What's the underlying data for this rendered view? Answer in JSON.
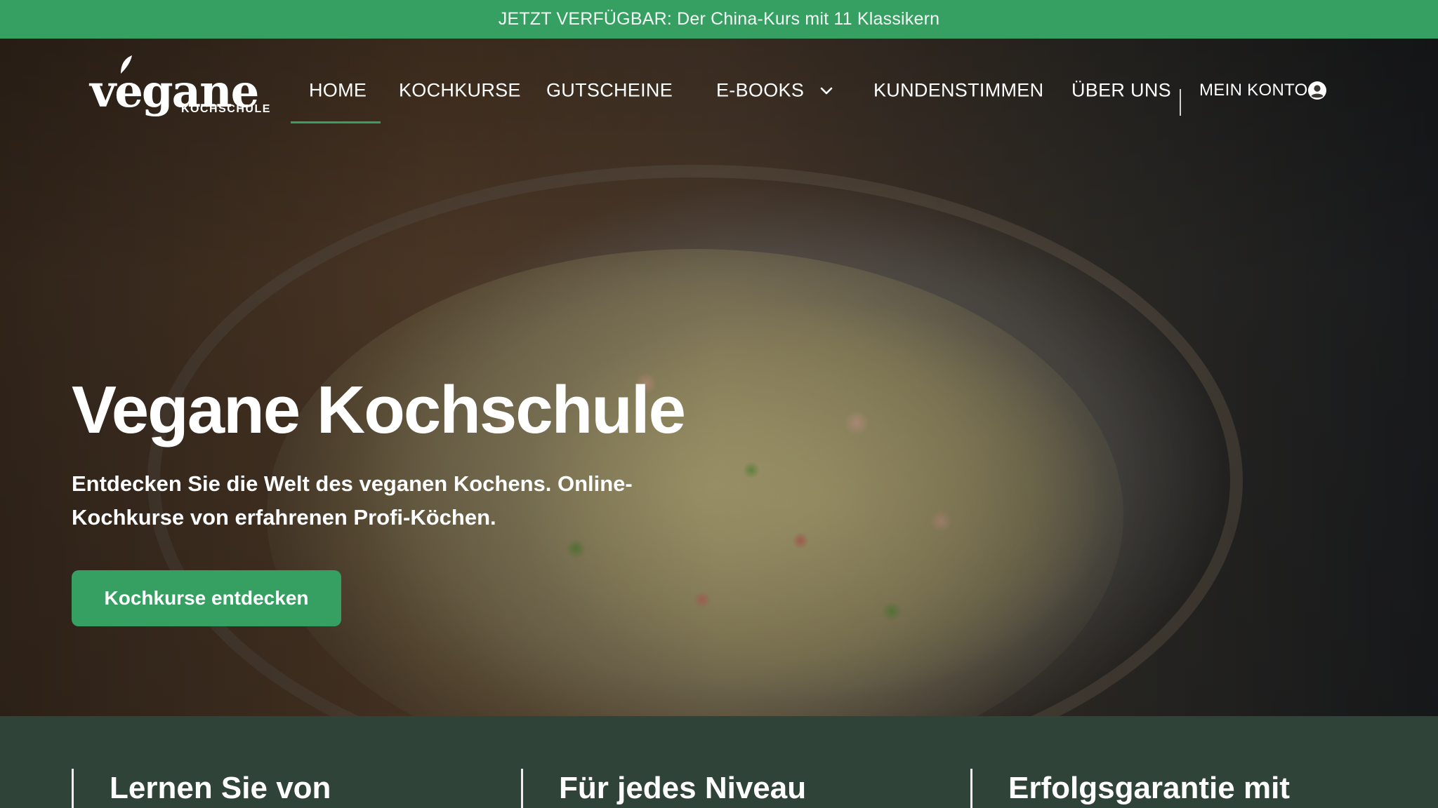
{
  "announcement": {
    "text": "JETZT VERFÜGBAR: Der China-Kurs mit 11 Klassikern"
  },
  "logo": {
    "wordmark": "vegane",
    "subtitle": "KOCHSCHULE"
  },
  "nav": {
    "items": [
      {
        "label": "HOME",
        "active": true
      },
      {
        "label": "KOCHKURSE"
      },
      {
        "label": "GUTSCHEINE"
      },
      {
        "label": "E-BOOKS",
        "has_dropdown": true
      },
      {
        "label": "KUNDENSTIMMEN"
      },
      {
        "label": "ÜBER UNS"
      }
    ],
    "account_label": "MEIN KONTO",
    "account_icon": "user-circle-icon",
    "dropdown_icon": "chevron-down-icon"
  },
  "hero": {
    "title": "Vegane Kochschule",
    "subtitle": "Entdecken Sie die Welt des veganen Kochens. Online-Kochkurse von erfahrenen Profi-Köchen.",
    "cta_label": "Kochkurse entdecken"
  },
  "features": [
    {
      "title": "Lernen Sie von"
    },
    {
      "title": "Für jedes Niveau"
    },
    {
      "title": "Erfolgsgarantie mit"
    }
  ],
  "colors": {
    "accent": "#35a062",
    "features_bg": "#2f4338"
  }
}
